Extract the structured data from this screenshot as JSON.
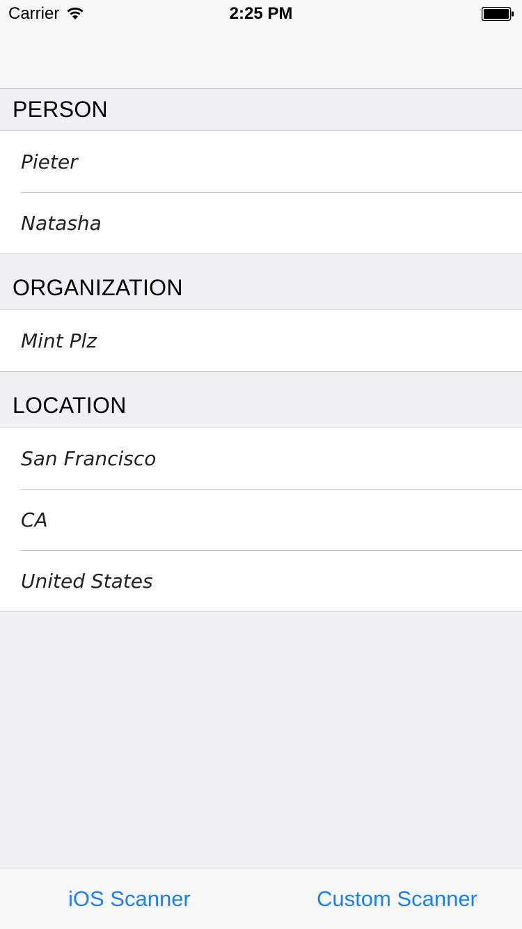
{
  "status_bar": {
    "carrier": "Carrier",
    "time": "2:25 PM"
  },
  "sections": [
    {
      "header": "PERSON",
      "items": [
        "Pieter",
        "Natasha"
      ]
    },
    {
      "header": "ORGANIZATION",
      "items": [
        "Mint Plz"
      ]
    },
    {
      "header": "LOCATION",
      "items": [
        "San Francisco",
        "CA",
        "United States"
      ]
    }
  ],
  "toolbar": {
    "ios_scanner_label": "iOS Scanner",
    "custom_scanner_label": "Custom Scanner"
  },
  "colors": {
    "accent": "#1a7ef0",
    "background": "#efeff4"
  }
}
